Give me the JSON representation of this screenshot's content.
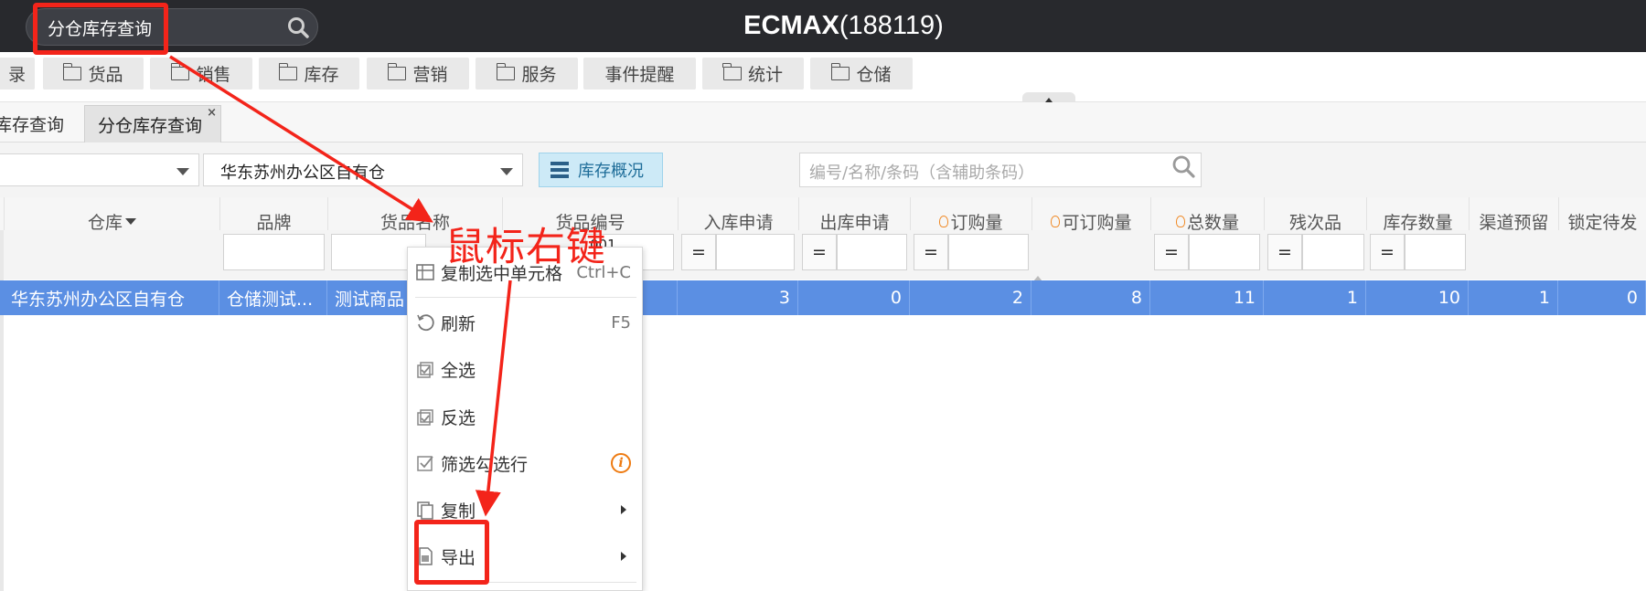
{
  "topbar": {
    "search_text": "分仓库存查询",
    "brand_bold": "ECMAX",
    "brand_code": "(188119)"
  },
  "menu": {
    "items": [
      {
        "label": "录",
        "icon": "none"
      },
      {
        "label": "货品",
        "icon": "folder-icon"
      },
      {
        "label": "销售",
        "icon": "folder-icon"
      },
      {
        "label": "库存",
        "icon": "folder-icon"
      },
      {
        "label": "营销",
        "icon": "folder-icon"
      },
      {
        "label": "服务",
        "icon": "folder-icon"
      },
      {
        "label": "事件提醒",
        "icon": "none"
      },
      {
        "label": "统计",
        "icon": "folder-icon"
      },
      {
        "label": "仓储",
        "icon": "folder-icon"
      }
    ]
  },
  "tabs": {
    "inactive": "库存查询",
    "active": "分仓库存查询",
    "close": "×"
  },
  "filters": {
    "warehouse_value": "华东苏州办公区自有仓",
    "overview_button": "库存概况",
    "keyword_placeholder": "编号/名称/条码（含辅助条码）"
  },
  "grid": {
    "columns": [
      "仓库",
      "品牌",
      "货品名称",
      "货品编号",
      "入库申请",
      "出库申请",
      "订购量",
      "可订购量",
      "总数量",
      "残次品",
      "库存数量",
      "渠道预留",
      "锁定待发"
    ],
    "filter_operator": "=",
    "partial_filter_text": "001",
    "row": [
      "华东苏州办公区自有仓",
      "仓储测试...",
      "测试商品",
      "",
      "3",
      "0",
      "2",
      "8",
      "11",
      "1",
      "10",
      "1",
      "0"
    ]
  },
  "context_menu": {
    "copy_cell": "复制选中单元格",
    "copy_cell_shortcut": "Ctrl+C",
    "refresh": "刷新",
    "refresh_shortcut": "F5",
    "select_all": "全选",
    "invert": "反选",
    "filter_checked": "筛选勾选行",
    "info": "i",
    "copy": "复制",
    "export": "导出"
  },
  "annotation": {
    "text": "鼠标右键",
    "color": "#f3241a"
  },
  "colors": {
    "topbar": "#28292d",
    "selected_row": "#5b8fe3",
    "overview_button": "#cdeaf7"
  }
}
